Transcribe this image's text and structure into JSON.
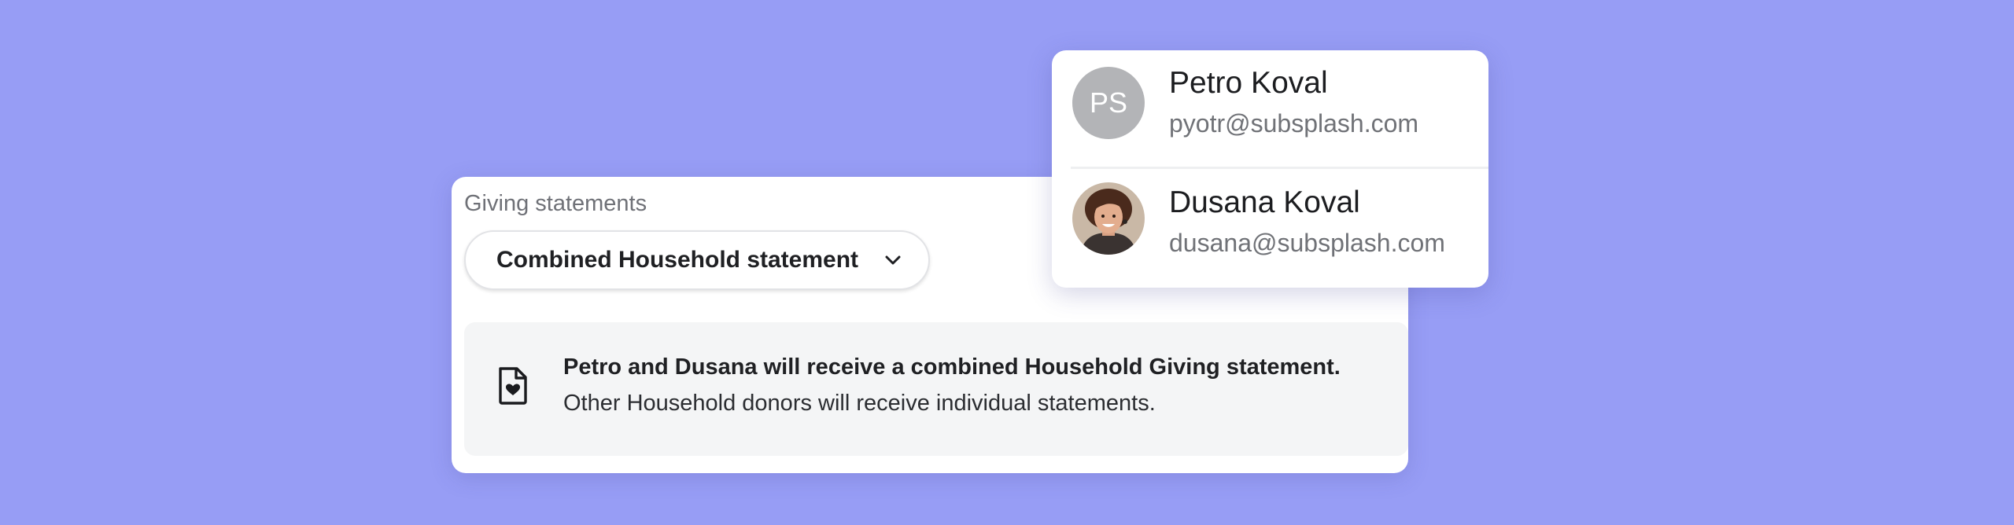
{
  "giving": {
    "section_label": "Giving statements",
    "statement_type": {
      "selected": "Combined Household statement",
      "icon": "chevron-down-icon"
    },
    "notice": {
      "icon": "document-heart-icon",
      "title": "Petro and Dusana will receive a combined Household Giving statement.",
      "body": "Other Household donors will receive individual statements."
    }
  },
  "household_members": [
    {
      "initials": "PS",
      "name": "Petro Koval",
      "email": "pyotr@subsplash.com"
    },
    {
      "name": "Dusana Koval",
      "email": "dusana@subsplash.com",
      "avatar": "photo"
    }
  ],
  "colors": {
    "background": "#979df5",
    "card": "#ffffff",
    "notice_bg": "#f4f5f6",
    "initials_avatar": "#b3b4b7"
  }
}
